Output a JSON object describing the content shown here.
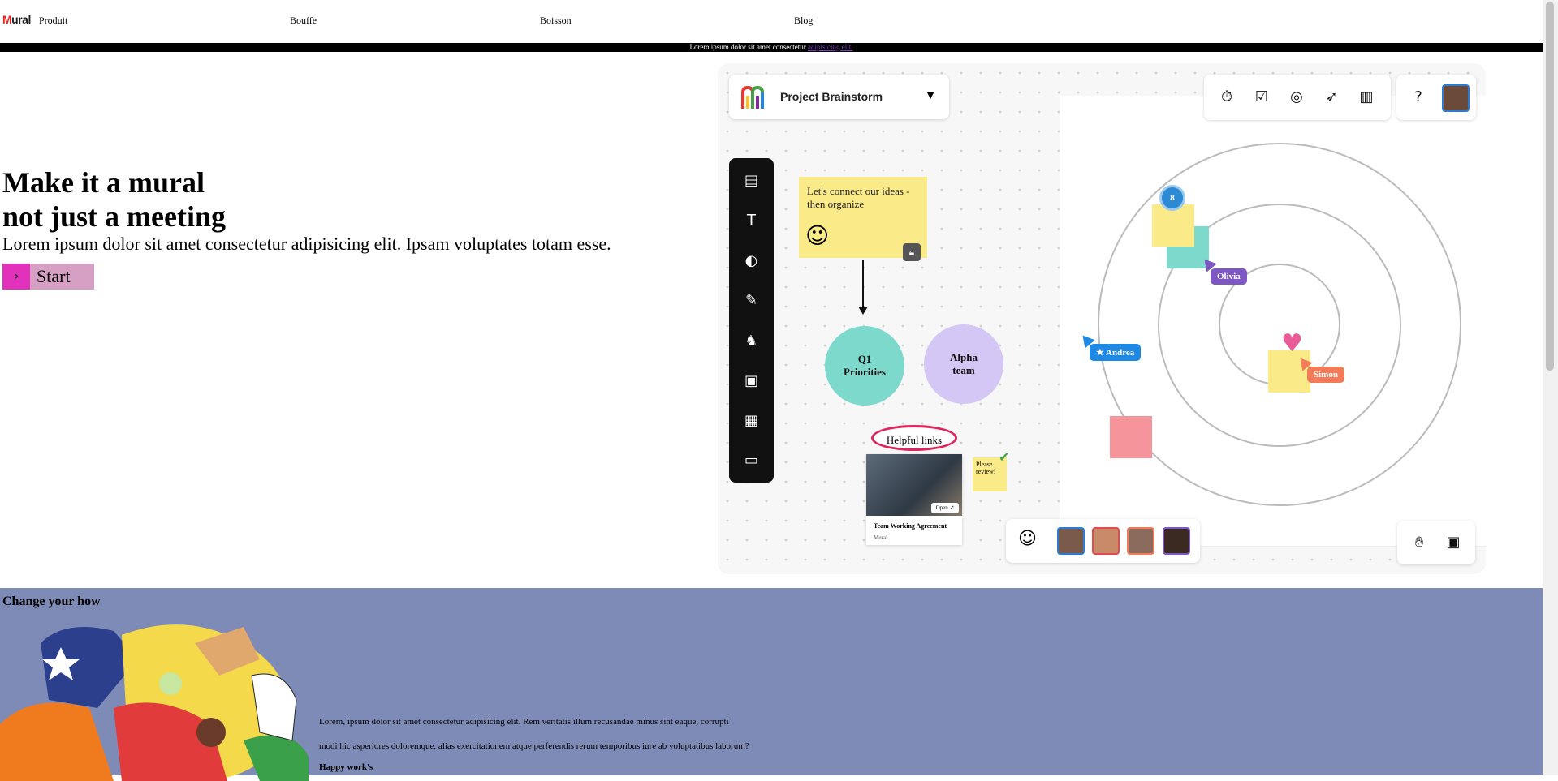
{
  "nav": {
    "logo": "Mural",
    "links": [
      "Produit",
      "Bouffe",
      "Boisson",
      "Blog"
    ]
  },
  "banner": {
    "text": "Lorem ipsum dolor sit amet consectetur",
    "link": "adipisicing elit."
  },
  "hero": {
    "title_line1": "Make it a mural",
    "title_line2": "not just a meeting",
    "subtitle": "Lorem ipsum dolor sit amet consectetur adipisicing elit. Ipsam voluptates totam esse.",
    "start_label": "Start",
    "start_icon": "chevron-right-icon"
  },
  "mural": {
    "project_name": "Project Brainstorm",
    "toolbar_icons": [
      "sticky-note-icon",
      "text-icon",
      "shapes-icon",
      "pen-icon",
      "llama-icon",
      "image-icon",
      "grid-icon",
      "archive-icon"
    ],
    "top_icons": [
      "timer-icon",
      "checkbox-icon",
      "private-mode-icon",
      "cursor-icon",
      "toolbox-icon",
      "help-icon"
    ],
    "sticky_text": "Let's connect our ideas - then organize",
    "circle_q1": "Q1 Priorities",
    "circle_alpha": "Alpha team",
    "helpful_links": "Helpful links",
    "card_title": "Team Working Agreement",
    "card_sub": "Mural",
    "card_open": "Open",
    "please_review": "Please review!",
    "badge_count": "8",
    "cursor_olivia": "Olivia",
    "cursor_andrea": "Andrea",
    "cursor_simon": "Simon",
    "colors": {
      "sticky_yellow": "#fbea88",
      "teal": "#7dd9cc",
      "lavender": "#d4c6f5",
      "olivia": "#7e57c2",
      "andrea": "#1e88e5",
      "simon": "#f27b5a",
      "pink": "#f5959b",
      "heart": "#ea5c98"
    }
  },
  "section2": {
    "title": "Change your how",
    "para_line1": "Lorem, ipsum dolor sit amet consectetur adipisicing elit. Rem veritatis illum recusandae minus sint eaque, corrupti",
    "para_line2": "modi hic asperiores doloremque, alias exercitationem atque perferendis rerum temporibus iure ab voluptatibus laborum?",
    "subtitle": "Happy work's"
  }
}
